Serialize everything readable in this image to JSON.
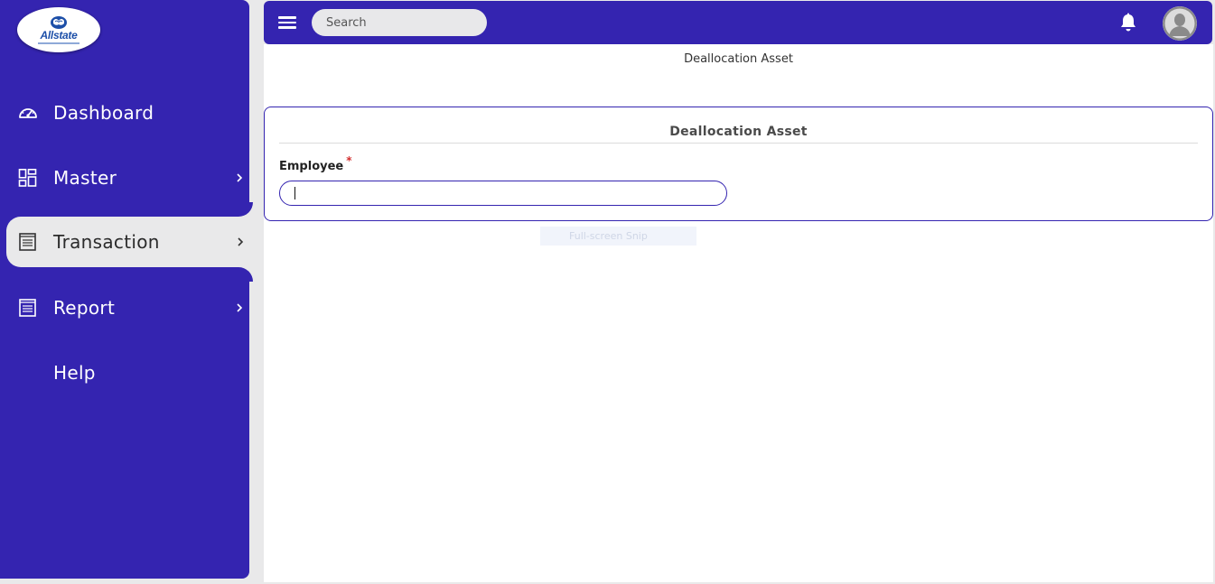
{
  "sidebar": {
    "logo_text": "Allstate",
    "items": [
      {
        "label": "Dashboard",
        "icon": "gauge-icon"
      },
      {
        "label": "Master",
        "icon": "grid-icon"
      },
      {
        "label": "Transaction",
        "icon": "ledger-icon"
      },
      {
        "label": "Report",
        "icon": "report-icon"
      },
      {
        "label": "Help",
        "icon": ""
      }
    ],
    "active_item": "Transaction"
  },
  "topbar": {
    "search_placeholder": "Search",
    "search_value": ""
  },
  "main": {
    "page_heading": "Deallocation Asset",
    "card": {
      "title": "Deallocation Asset",
      "employee_label": "Employee",
      "required_marker": "*",
      "employee_value": ""
    },
    "overlay_ghost": "Full-screen Snip"
  },
  "colors": {
    "brand": "#3424b0",
    "background": "#e9e9ea",
    "required": "#d32f2f"
  }
}
